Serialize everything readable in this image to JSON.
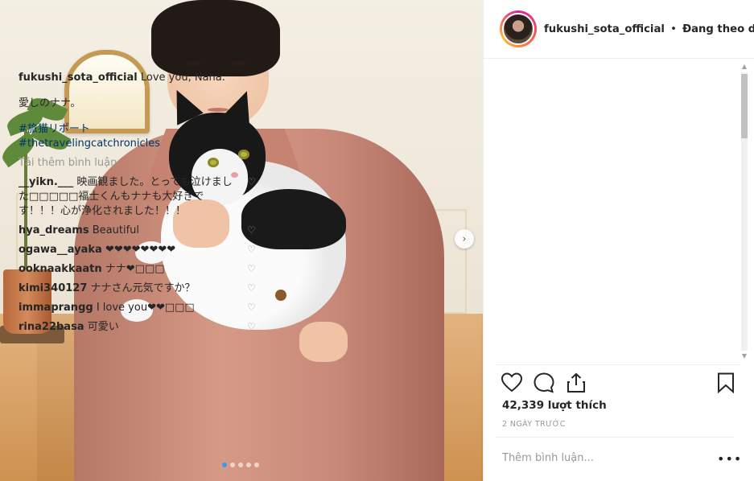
{
  "post": {
    "username": "fukushi_sota_official",
    "separator": "•",
    "follow_label": "Đang theo dõi"
  },
  "caption": {
    "username": "fukushi_sota_official",
    "text": "Love you, Nana.",
    "line2": "愛しのナナ。",
    "tags": [
      "#旅猫リポート",
      "#thetravelingcatchronicles"
    ]
  },
  "load_more": "Tải thêm bình luận",
  "comments": [
    {
      "user": "__yikn.___",
      "text": "映画観ました。とっても泣けました□□□□□福士くんもナナも大好きです！！！心が浄化されました！！！"
    },
    {
      "user": "hya_dreams",
      "text": "Beautiful"
    },
    {
      "user": "ogawa__ayaka",
      "text": "❤❤❤❤❤❤❤❤"
    },
    {
      "user": "ooknaakkaatn",
      "text": "ナナ❤□□□"
    },
    {
      "user": "kimi340127",
      "text": "ナナさん元気ですか？"
    },
    {
      "user": "immaprangg",
      "text": "I love you❤❤□□□"
    },
    {
      "user": "rina22basa",
      "text": "可愛い"
    }
  ],
  "likes": "42,339 lượt thích",
  "time": "2 NGÀY TRƯỚC",
  "add_comment_placeholder": "Thêm bình luận...",
  "more_options": "•••",
  "carousel": {
    "total": 5,
    "active": 0
  },
  "icons": {
    "like": "heart-icon",
    "comment": "comment-icon",
    "share": "share-icon",
    "save": "bookmark-icon",
    "next": "chevron-right-icon"
  },
  "colors": {
    "link": "#003569",
    "muted": "#999999",
    "dot_active": "#3897f0"
  }
}
